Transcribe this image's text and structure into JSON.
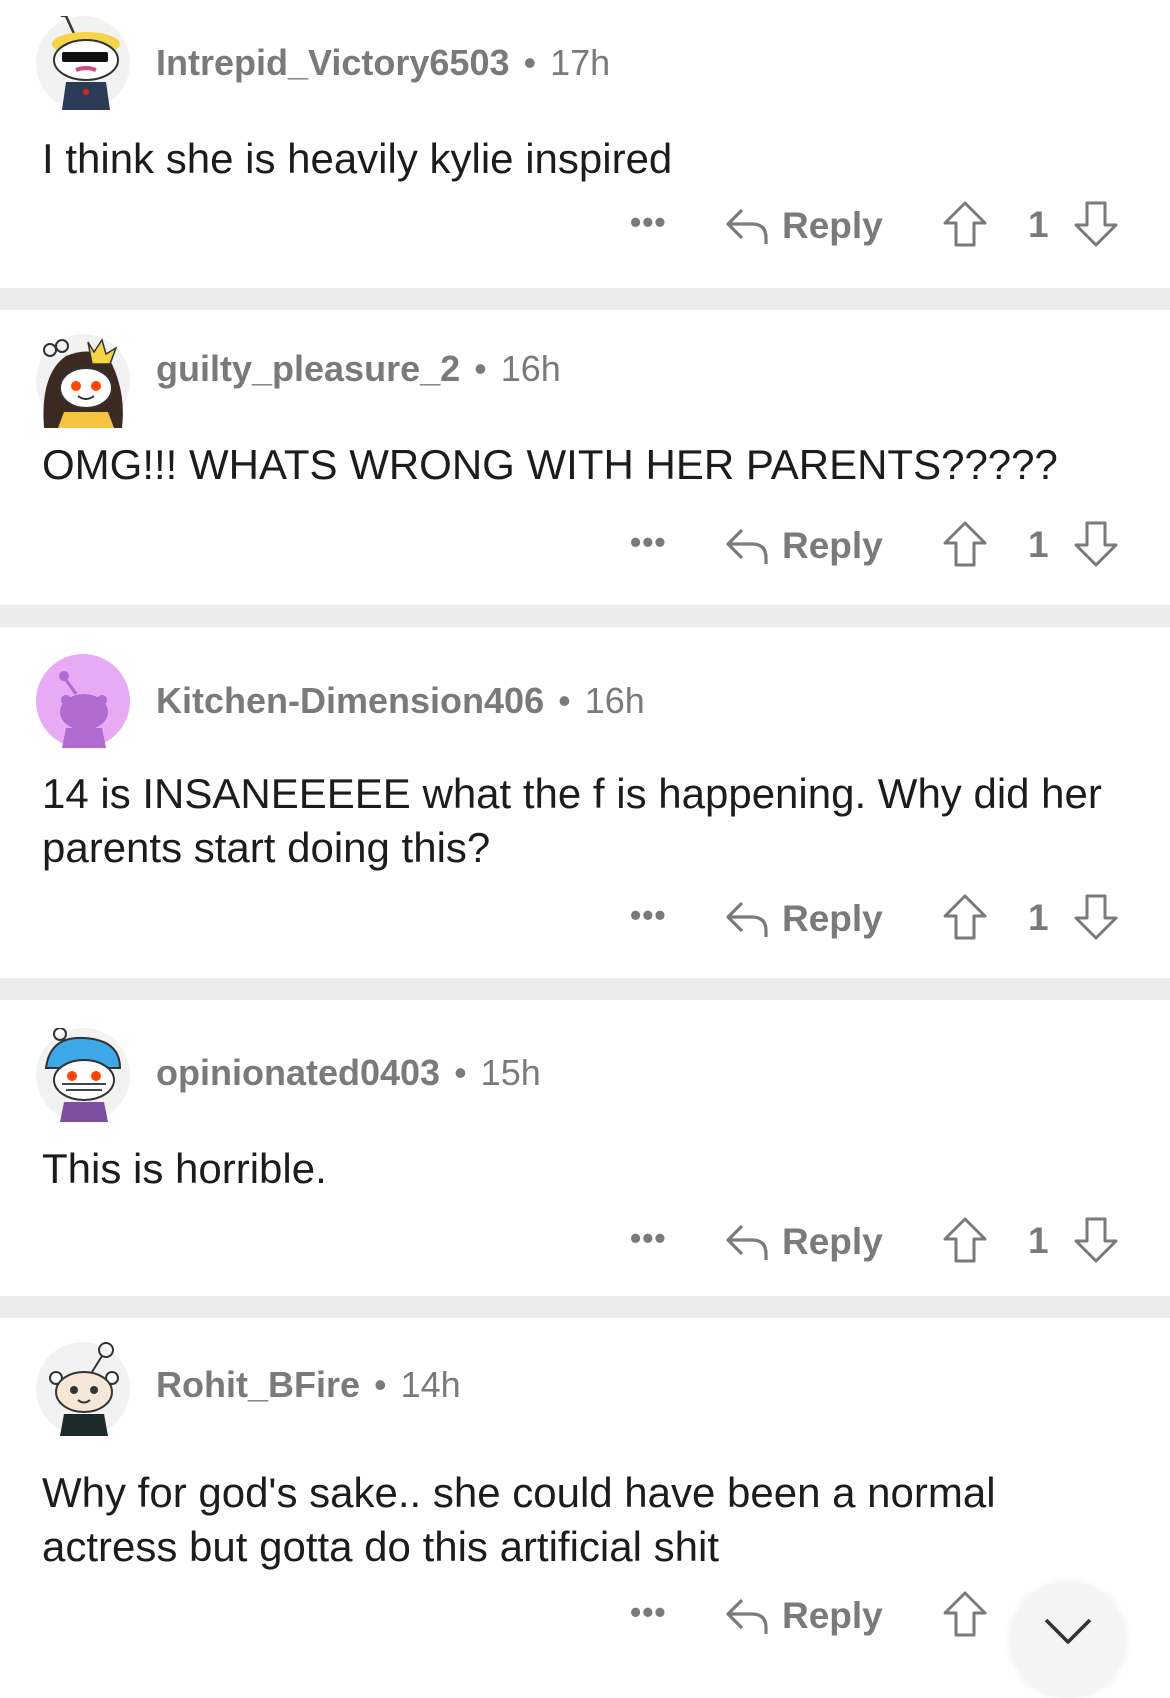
{
  "comments": [
    {
      "username": "Intrepid_Victory6503",
      "separator": "•",
      "age": "17h",
      "text": "I think she is heavily kylie inspired",
      "more": "•••",
      "reply_label": "Reply",
      "votes": "1",
      "avatar_icon": "snoo-sunglasses-avatar"
    },
    {
      "username": "guilty_pleasure_2",
      "separator": "•",
      "age": "16h",
      "text": "OMG!!! WHATS WRONG WITH HER PARENTS?????",
      "more": "•••",
      "reply_label": "Reply",
      "votes": "1",
      "avatar_icon": "snoo-crown-avatar"
    },
    {
      "username": "Kitchen-Dimension406",
      "separator": "•",
      "age": "16h",
      "text": "14 is INSANEEEEE what the f is happening. Why did her parents start doing this?",
      "more": "•••",
      "reply_label": "Reply",
      "votes": "1",
      "avatar_icon": "snoo-default-avatar"
    },
    {
      "username": "opinionated0403",
      "separator": "•",
      "age": "15h",
      "text": "This is horrible.",
      "more": "•••",
      "reply_label": "Reply",
      "votes": "1",
      "avatar_icon": "snoo-helmet-avatar"
    },
    {
      "username": "Rohit_BFire",
      "separator": "•",
      "age": "14h",
      "text": "Why for god's sake.. she could have been a normal actress but gotta do this artificial shit",
      "more": "•••",
      "reply_label": "Reply",
      "votes": "",
      "avatar_icon": "snoo-basic-avatar"
    }
  ],
  "colors": {
    "meta_text": "#7a7a7a",
    "body_text": "#1c1c1c",
    "separator": "#ececec",
    "avatar_purple": "#e8a9f5"
  },
  "icons": {
    "reply": "reply-arrow-icon",
    "upvote": "upvote-arrow-icon",
    "downvote": "downvote-arrow-icon",
    "scroll": "chevron-down-icon"
  }
}
